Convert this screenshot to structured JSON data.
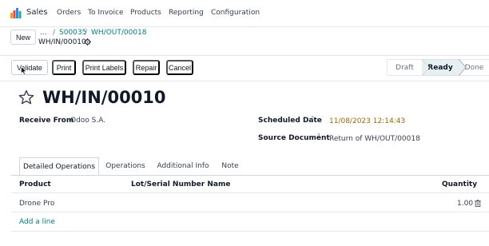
{
  "app": {
    "name": "Sales",
    "logo_colors": [
      "#f59e0b",
      "#ef4444",
      "#3b82f6",
      "#10b981"
    ]
  },
  "nav": {
    "items": [
      "Orders",
      "To Invoice",
      "Products",
      "Reporting",
      "Configuration"
    ]
  },
  "breadcrumb": {
    "new_label": "New",
    "dots": "...",
    "sep": "/",
    "links": [
      "S00035",
      "WH/OUT/00018"
    ],
    "current": "WH/IN/00010"
  },
  "actions": {
    "validate": "Validate",
    "print": "Print",
    "print_labels": "Print Labels",
    "repair": "Repair",
    "cancel": "Cancel"
  },
  "status": {
    "stages": [
      "Draft",
      "Ready",
      "Done"
    ],
    "active": "Ready"
  },
  "record": {
    "title": "WH/IN/00010",
    "receive_from_label": "Receive From",
    "receive_from_value": "Odoo S.A.",
    "scheduled_date_label": "Scheduled Date",
    "scheduled_date_value": "11/08/2023 12:14:43",
    "source_document_label": "Source Document",
    "source_document_value": "Return of WH/OUT/00018",
    "help_mark": "?"
  },
  "tabs": [
    "Detailed Operations",
    "Operations",
    "Additional Info",
    "Note"
  ],
  "table": {
    "headers": [
      "Product",
      "Lot/Serial Number Name",
      "Quantity"
    ],
    "rows": [
      {
        "product": "Drone Pro",
        "lot": "",
        "quantity": "1.00"
      }
    ],
    "add_line": "Add a line"
  },
  "colors": {
    "link": "#017e84",
    "date": "#9a6a00",
    "ready_bg": "#e6f0f0"
  }
}
